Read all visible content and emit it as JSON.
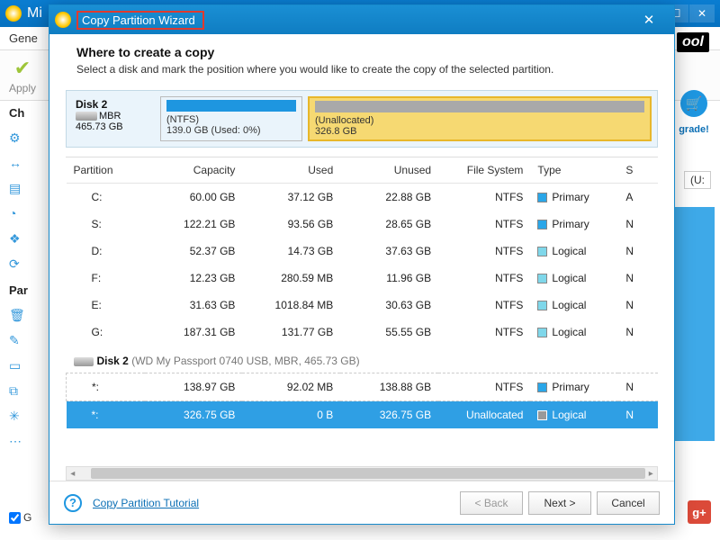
{
  "bg": {
    "title_prefix": "Mi",
    "menu": {
      "general": "Gene"
    },
    "apply": "Apply",
    "side1": "Ch",
    "side2": "Par",
    "upgrade": "grade!",
    "g": "G",
    "u": "(U:",
    "logo": "ool"
  },
  "modal": {
    "title": "Copy Partition Wizard",
    "heading": "Where to create a copy",
    "sub": "Select a disk and mark the position where you would like to create the copy of the selected partition.",
    "disk": {
      "name": "Disk 2",
      "scheme": "MBR",
      "size": "465.73 GB",
      "ntfs": {
        "label": "(NTFS)",
        "detail": "139.0 GB (Used: 0%)"
      },
      "unalloc": {
        "label": "(Unallocated)",
        "detail": "326.8 GB"
      }
    },
    "cols": [
      "Partition",
      "Capacity",
      "Used",
      "Unused",
      "File System",
      "Type",
      "S"
    ],
    "rows": [
      {
        "p": "C:",
        "cap": "60.00 GB",
        "used": "37.12 GB",
        "un": "22.88 GB",
        "fs": "NTFS",
        "type": "Primary",
        "sw": "sw-p",
        "s": "A"
      },
      {
        "p": "S:",
        "cap": "122.21 GB",
        "used": "93.56 GB",
        "un": "28.65 GB",
        "fs": "NTFS",
        "type": "Primary",
        "sw": "sw-p",
        "s": "N"
      },
      {
        "p": "D:",
        "cap": "52.37 GB",
        "used": "14.73 GB",
        "un": "37.63 GB",
        "fs": "NTFS",
        "type": "Logical",
        "sw": "sw-l",
        "s": "N"
      },
      {
        "p": "F:",
        "cap": "12.23 GB",
        "used": "280.59 MB",
        "un": "11.96 GB",
        "fs": "NTFS",
        "type": "Logical",
        "sw": "sw-l",
        "s": "N"
      },
      {
        "p": "E:",
        "cap": "31.63 GB",
        "used": "1018.84 MB",
        "un": "30.63 GB",
        "fs": "NTFS",
        "type": "Logical",
        "sw": "sw-l",
        "s": "N"
      },
      {
        "p": "G:",
        "cap": "187.31 GB",
        "used": "131.77 GB",
        "un": "55.55 GB",
        "fs": "NTFS",
        "type": "Logical",
        "sw": "sw-l",
        "s": "N"
      }
    ],
    "disk2label": "Disk 2",
    "disk2detail": "(WD My Passport 0740 USB, MBR, 465.73 GB)",
    "rows2": [
      {
        "p": "*:",
        "cap": "138.97 GB",
        "used": "92.02 MB",
        "un": "138.88 GB",
        "fs": "NTFS",
        "type": "Primary",
        "sw": "sw-p",
        "s": "N",
        "sel": false
      },
      {
        "p": "*:",
        "cap": "326.75 GB",
        "used": "0 B",
        "un": "326.75 GB",
        "fs": "Unallocated",
        "type": "Logical",
        "sw": "sw-u",
        "s": "N",
        "sel": true
      }
    ],
    "tutorial": "Copy Partition Tutorial",
    "back": "< Back",
    "next": "Next >",
    "cancel": "Cancel"
  }
}
